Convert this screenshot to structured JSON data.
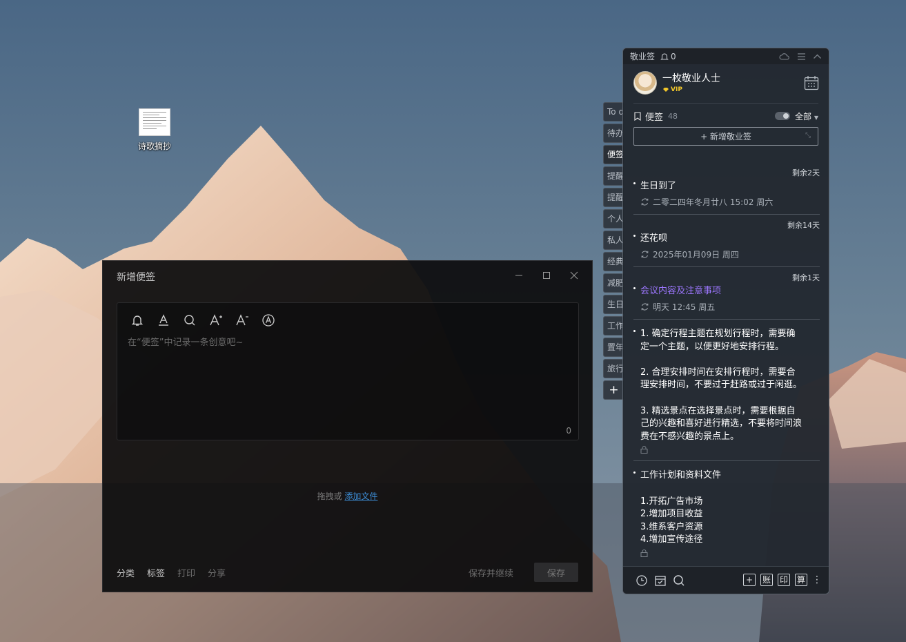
{
  "desktop": {
    "icon_label": "诗歌摘抄"
  },
  "note_window": {
    "title": "新增便签",
    "placeholder": "在“便签”中记录一条创意吧~",
    "char_count": "0",
    "drop_text": "拖拽或",
    "drop_link": "添加文件",
    "footer_left": [
      "分类",
      "标签",
      "打印",
      "分享"
    ],
    "save_continue": "保存并继续",
    "save": "保存",
    "toolbar_icons": [
      "bell-icon",
      "font-color-icon",
      "search-icon",
      "font-increase-icon",
      "font-decrease-icon",
      "font-style-icon"
    ]
  },
  "side_tabs": [
    "To do",
    "待办",
    "便签",
    "提醒",
    "提醒",
    "个人",
    "私人",
    "经典",
    "减肥",
    "生日",
    "工作",
    "置年",
    "旅行",
    "+"
  ],
  "panel": {
    "app_name": "敬业签",
    "reminder_count": "0",
    "username": "一枚敬业人士",
    "vip": "VIP",
    "category": "便签",
    "category_count": "48",
    "filter": "全部",
    "add_note": "+ 新增敬业签",
    "notes": [
      {
        "remain": "剩余2天",
        "title": "生日到了",
        "date": "二零二四年冬月廿八 15:02 周六"
      },
      {
        "remain": "剩余14天",
        "title": "还花呗",
        "date": "2025年01月09日 周四"
      },
      {
        "remain": "剩余1天",
        "title": "会议内容及注意事项",
        "date": "明天 12:45 周五"
      }
    ],
    "note4_lines": [
      "1. 确定行程主题在规划行程时，需要确",
      "定一个主题，以便更好地安排行程。",
      "",
      "2. 合理安排时间在安排行程时，需要合",
      "理安排时间，不要过于赶路或过于闲逛。",
      "",
      "3. 精选景点在选择景点时，需要根据自",
      "己的兴趣和喜好进行精选，不要将时间浪",
      "费在不感兴趣的景点上。"
    ],
    "note5_lines": [
      "工作计划和资料文件",
      "",
      "1.开拓广告市场",
      "2.增加项目收益",
      "3.维系客户资源",
      "4.增加宣传途径"
    ],
    "footer_buttons": [
      "+",
      "账",
      "印",
      "算"
    ],
    "colors": {
      "accent_purple": "#9d77ff",
      "link_blue": "#3d8fd9",
      "vip_gold": "#f3c82a"
    }
  }
}
